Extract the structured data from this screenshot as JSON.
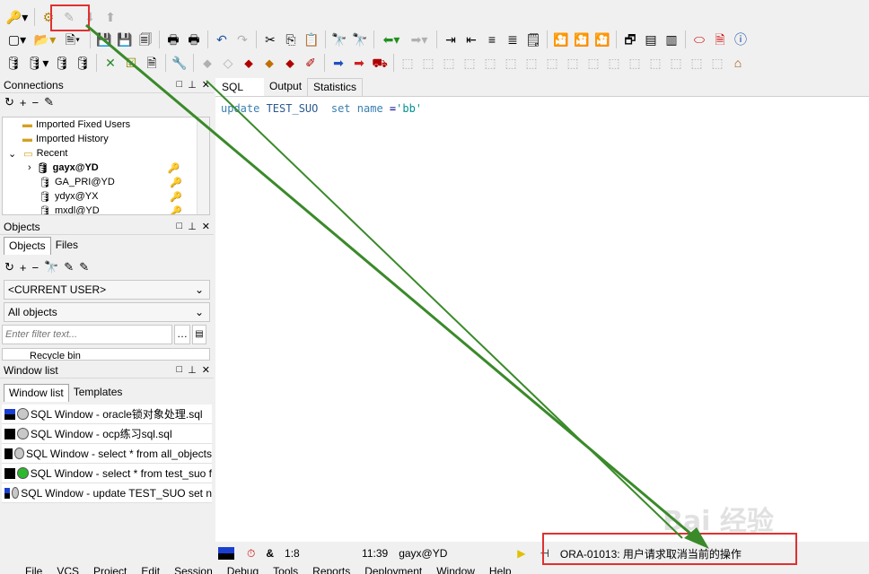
{
  "connections": {
    "title": "Connections",
    "tree": [
      {
        "label": "Imported Fixed Users"
      },
      {
        "label": "Imported History"
      },
      {
        "label": "Recent"
      },
      {
        "label": "gayx@YD"
      },
      {
        "label": "GA_PRI@YD"
      },
      {
        "label": "ydyx@YX"
      },
      {
        "label": "mxdl@YD"
      }
    ]
  },
  "objects": {
    "title": "Objects",
    "tabs": [
      "Objects",
      "Files"
    ],
    "user_select": "<CURRENT USER>",
    "type_select": "All objects",
    "filter_placeholder": "Enter filter text...",
    "partial_item": "Recycle bin"
  },
  "window_list": {
    "title": "Window list",
    "tabs": [
      "Window list",
      "Templates"
    ],
    "items": [
      {
        "label": "SQL Window - oracle锁对象处理.sql",
        "db_color": "#c8c8c8"
      },
      {
        "label": "SQL Window - ocp练习sql.sql",
        "db_color": "#c8c8c8"
      },
      {
        "label": "SQL Window - select * from all_objects",
        "db_color": "#c8c8c8"
      },
      {
        "label": "SQL Window - select * from test_suo f",
        "db_color": "#2eb82e"
      },
      {
        "label": "SQL Window - update TEST_SUO set n",
        "db_color": "#c8c8c8"
      }
    ]
  },
  "editor": {
    "tabs": [
      "SQL",
      "Output",
      "Statistics"
    ],
    "code_kw1": "update",
    "code_ident": " TEST_SUO  ",
    "code_kw2": "set",
    "code_sp": " ",
    "code_kw3": "name",
    "code_op": " =",
    "code_str": "'bb'"
  },
  "status": {
    "position": "1:8",
    "time": "11:39",
    "connection": "gayx@YD",
    "message": "ORA-01013: 用户请求取消当前的操作"
  },
  "menu": [
    "File",
    "VCS",
    "Project",
    "Edit",
    "Session",
    "Debug",
    "Tools",
    "Reports",
    "Deployment",
    "Window",
    "Help"
  ],
  "colors": {
    "annotation_red": "#e03030",
    "arrow_green": "#3a8a2a"
  }
}
